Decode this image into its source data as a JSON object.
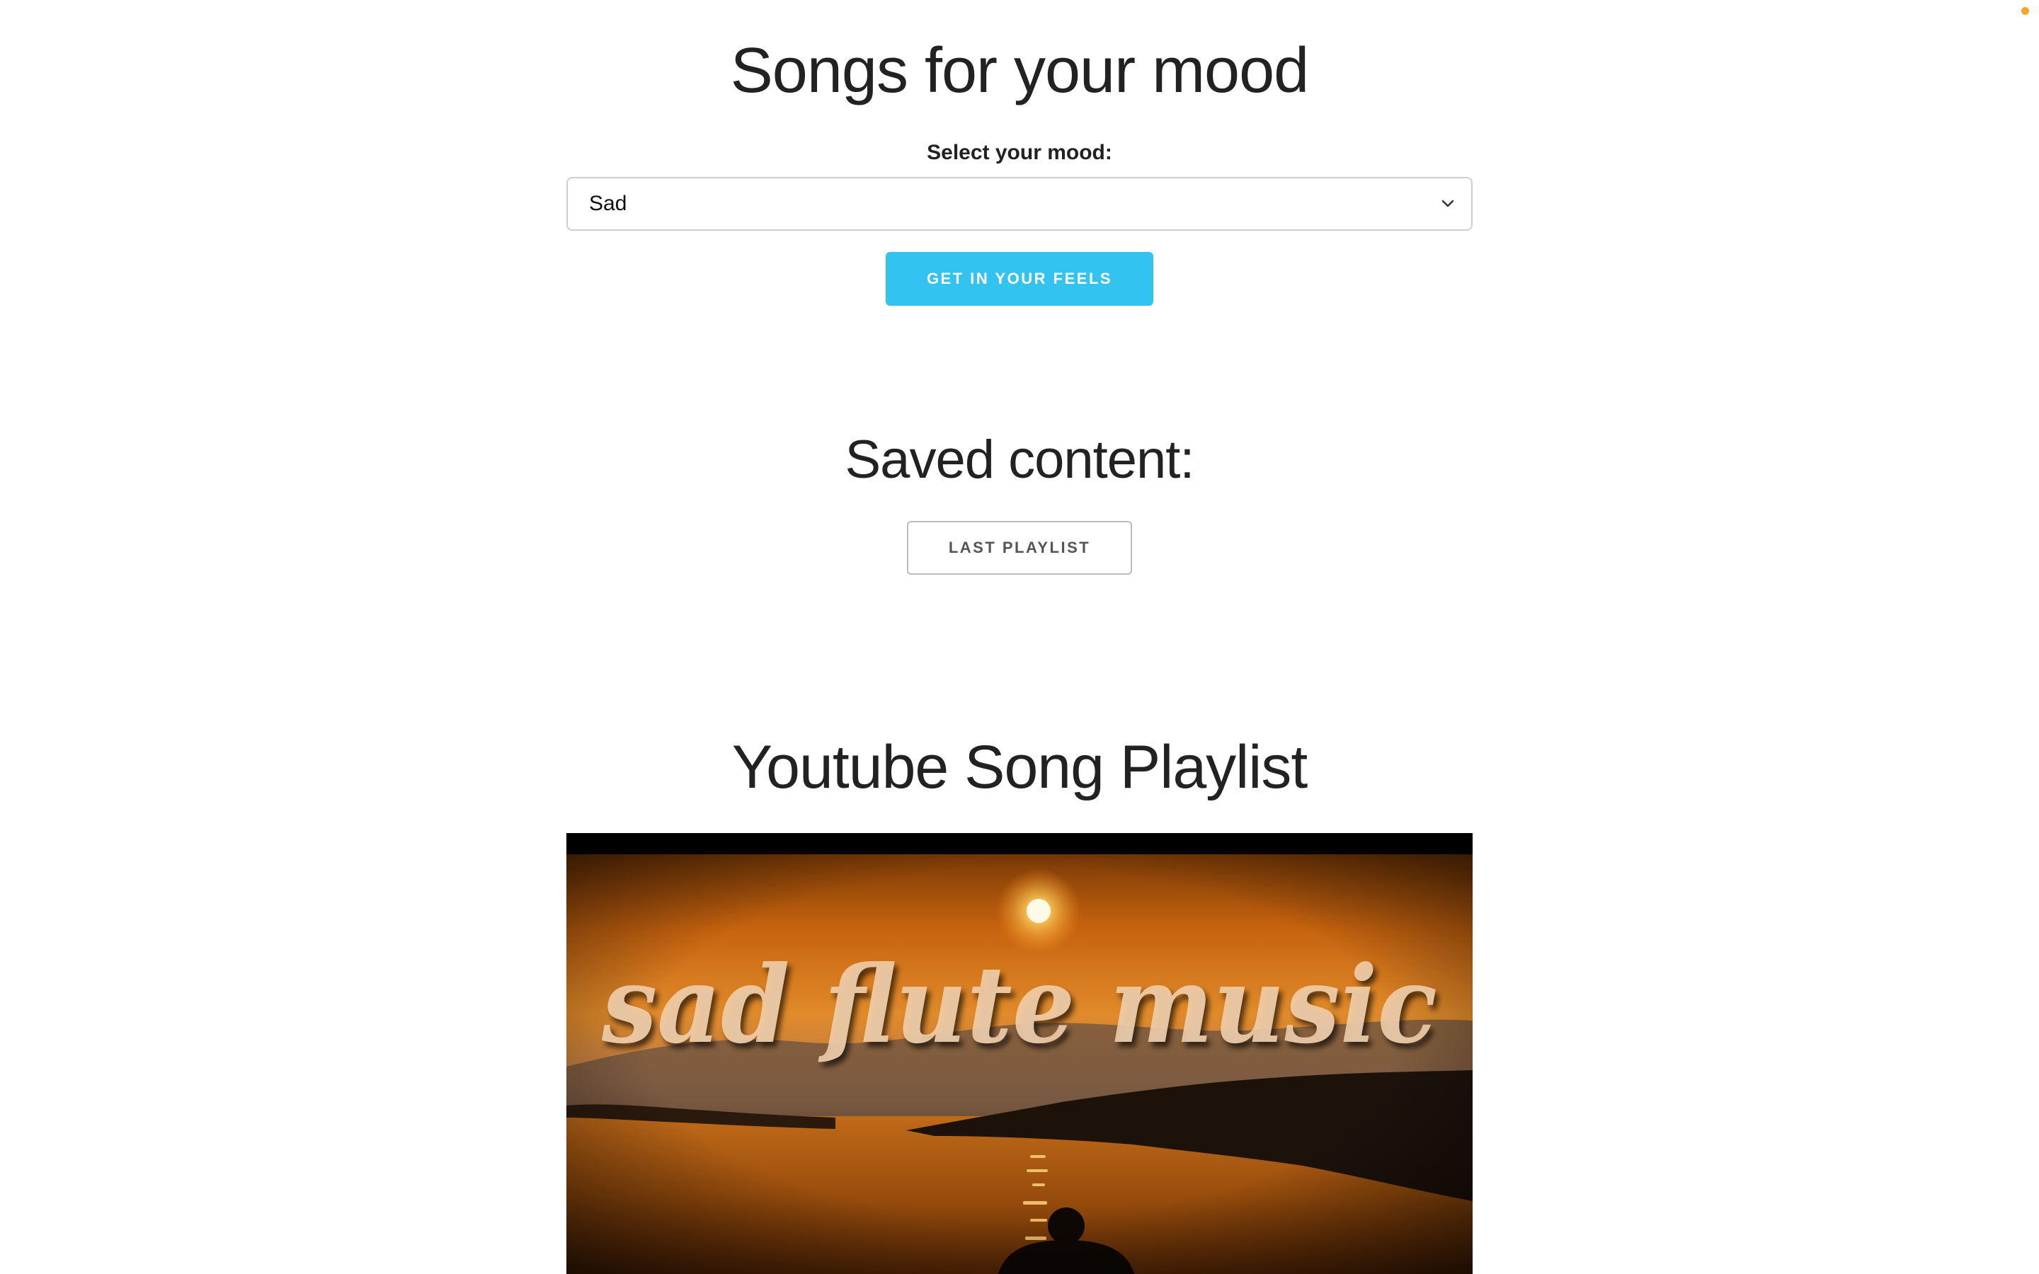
{
  "header": {
    "title": "Songs for your mood"
  },
  "mood_form": {
    "label": "Select your mood:",
    "selected_value": "Sad",
    "submit_label": "GET IN YOUR FEELS"
  },
  "saved": {
    "title": "Saved content:",
    "last_playlist_label": "LAST PLAYLIST"
  },
  "playlist": {
    "title": "Youtube Song Playlist",
    "video_thumbnail_text": "sad flute music"
  },
  "colors": {
    "accent": "#33c3f0",
    "status_dot": "#f5a623"
  }
}
